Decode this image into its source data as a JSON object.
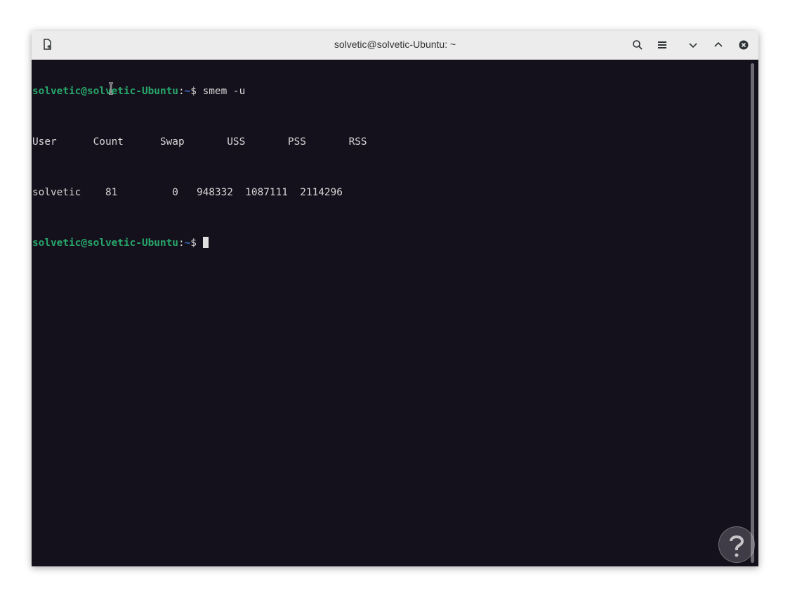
{
  "window": {
    "title": "solvetic@solvetic-Ubuntu: ~"
  },
  "titlebar_icons": {
    "new_tab": "new-tab-icon",
    "search": "search-icon",
    "menu": "hamburger-menu-icon",
    "minimize": "chevron-down-icon",
    "maximize": "chevron-up-icon",
    "close": "close-icon"
  },
  "terminal": {
    "prompt1": {
      "user_host": "solvetic@solvetic-Ubuntu",
      "sep": ":",
      "path": "~",
      "dollar": "$ ",
      "command": "smem -u"
    },
    "header": {
      "user": "User",
      "count": "Count",
      "swap": "Swap",
      "uss": "USS",
      "pss": "PSS",
      "rss": "RSS"
    },
    "row": {
      "user": "solvetic",
      "count": "81",
      "swap": "0",
      "uss": "948332",
      "pss": "1087111",
      "rss": "2114296"
    },
    "prompt2": {
      "user_host": "solvetic@solvetic-Ubuntu",
      "sep": ":",
      "path": "~",
      "dollar": "$ "
    }
  },
  "colors": {
    "terminal_bg": "#15111c",
    "prompt_green": "#27a66b",
    "path_blue": "#3b74c9",
    "text": "#d6d6d6"
  }
}
